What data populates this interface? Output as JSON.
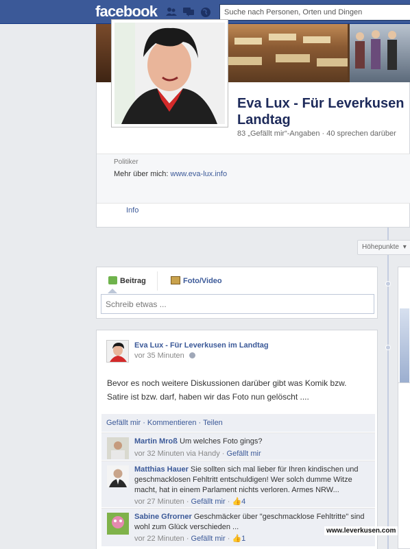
{
  "topbar": {
    "logo": "facebook",
    "search_placeholder": "Suche nach Personen, Orten und Dingen"
  },
  "page": {
    "name_line1": "Eva Lux - Für Leverkusen",
    "name_line2": "Landtag",
    "stats": "83 „Gefällt mir“-Angaben · 40 sprechen darüber",
    "category": "Politiker",
    "about_prefix": "Mehr über mich: ",
    "about_link": "www.eva-lux.info",
    "info_tab": "Info"
  },
  "timeline": {
    "highlights": "Höhepunkte"
  },
  "composer": {
    "tab_post": "Beitrag",
    "tab_photo": "Foto/Video",
    "placeholder": "Schreib etwas ..."
  },
  "post": {
    "author": "Eva Lux - Für Leverkusen im Landtag",
    "time": "vor 35 Minuten",
    "text": "Bevor es noch weitere Diskussionen darüber gibt was Komik bzw. Satire ist bzw. darf, haben wir das Foto nun gelöscht ....",
    "actions": {
      "like": "Gefällt mir",
      "comment": "Kommentieren",
      "share": "Teilen"
    },
    "comments": [
      {
        "author": "Martin Mroß",
        "text": "Um welches Foto gings?",
        "time": "vor 32 Minuten via Handy",
        "like": "Gefällt mir",
        "likes": ""
      },
      {
        "author": "Matthias Hauer",
        "text": "Sie sollten sich mal lieber für Ihren kindischen und geschmacklosen Fehltritt entschuldigen! Wer solch dumme Witze macht, hat in einem Parlament nichts verloren. Armes NRW...",
        "time": "vor 27 Minuten",
        "like": "Gefällt mir",
        "likes": "4"
      },
      {
        "author": "Sabine Gfrorner",
        "text": "Geschmäcker über \"geschmacklose Fehltritte\" sind wohl zum Glück verschieden ...",
        "time": "vor 22 Minuten",
        "like": "Gefällt mir",
        "likes": "1"
      }
    ]
  },
  "watermark": "www.leverkusen.com",
  "colors": {
    "brand": "#3b5998",
    "link": "#3b5998",
    "background": "#e9ebee"
  }
}
